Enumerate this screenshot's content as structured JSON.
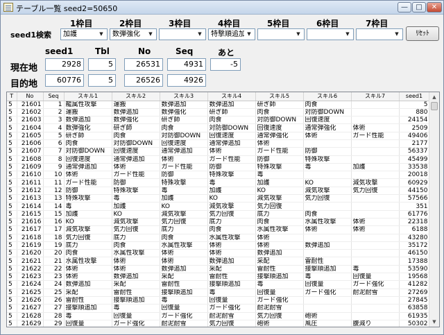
{
  "window": {
    "title": "テーブル一覧 seed2=50650",
    "min_glyph": "—",
    "max_glyph": "□",
    "close_glyph": "✕"
  },
  "search": {
    "label": "seed1検索",
    "frames": [
      {
        "label": "1枠目",
        "value": "加護"
      },
      {
        "label": "2枠目",
        "value": "数弾強化"
      },
      {
        "label": "3枠目",
        "value": ""
      },
      {
        "label": "4枠目",
        "value": "特撃順追加"
      },
      {
        "label": "5枠目",
        "value": ""
      },
      {
        "label": "6枠目",
        "value": ""
      },
      {
        "label": "7枠目",
        "value": ""
      }
    ],
    "reset_label": "ﾘｾｯﾄ",
    "arrow_glyph": "▼"
  },
  "status": {
    "headers": {
      "seed1": "seed1",
      "tbl": "Tbl",
      "no": "No",
      "seq": "Seq",
      "ato": "あと"
    },
    "current": {
      "label": "現在地",
      "seed1": "2928",
      "tbl": "5",
      "no": "26531",
      "seq": "4931",
      "ato": "-5"
    },
    "target": {
      "label": "目的地",
      "seed1": "60776",
      "tbl": "5",
      "no": "26526",
      "seq": "4926"
    }
  },
  "table": {
    "columns": [
      "T",
      "No",
      "Seq",
      "スキル1",
      "スキル2",
      "スキル3",
      "スキル4",
      "スキル5",
      "スキル6",
      "スキル7",
      "seed1"
    ],
    "rows": [
      [
        "5",
        "21601",
        "1",
        "龍属性攻撃",
        "運搬",
        "数弾追加",
        "数弾追加",
        "研ぎ師",
        "肉食",
        "",
        "5"
      ],
      [
        "5",
        "21602",
        "2",
        "運搬",
        "数弾追加",
        "数弾強化",
        "研ぎ師",
        "肉食",
        "対防御DOWN",
        "",
        "880"
      ],
      [
        "5",
        "21603",
        "3",
        "数弾追加",
        "数弾強化",
        "研ぎ師",
        "肉食",
        "対防御DOWN",
        "回復速度",
        "",
        "24154"
      ],
      [
        "5",
        "21604",
        "4",
        "数弾強化",
        "研ぎ師",
        "肉食",
        "対防御DOWN",
        "回復速度",
        "通常弾強化",
        "体術",
        "2509"
      ],
      [
        "5",
        "21605",
        "5",
        "研ぎ師",
        "肉食",
        "対防御DOWN",
        "回復速度",
        "通常弾強化",
        "体術",
        "ガード性能",
        "49406"
      ],
      [
        "5",
        "21606",
        "6",
        "肉食",
        "対防御DOWN",
        "回復速度",
        "通常弾追加",
        "体術",
        "",
        "",
        "2177"
      ],
      [
        "5",
        "21607",
        "7",
        "対防御DOWN",
        "回復速度",
        "通常弾追加",
        "体術",
        "ガード性能",
        "防御",
        "",
        "56337"
      ],
      [
        "5",
        "21608",
        "8",
        "回復速度",
        "通常弾追加",
        "体術",
        "ガード性能",
        "防御",
        "特殊攻撃",
        "",
        "45499"
      ],
      [
        "5",
        "21609",
        "9",
        "通常弾追加",
        "体術",
        "ガード性能",
        "防御",
        "特殊攻撃",
        "毒",
        "加護",
        "33538"
      ],
      [
        "5",
        "21610",
        "10",
        "体術",
        "ガード性能",
        "防御",
        "特殊攻撃",
        "毒",
        "",
        "",
        "20018"
      ],
      [
        "5",
        "21611",
        "11",
        "ガード性能",
        "防御",
        "特殊攻撃",
        "毒",
        "加護",
        "KO",
        "減気攻撃",
        "60929"
      ],
      [
        "5",
        "21612",
        "12",
        "防御",
        "特殊攻撃",
        "毒",
        "加護",
        "KO",
        "減気攻撃",
        "気力回復",
        "44150"
      ],
      [
        "5",
        "21613",
        "13",
        "特殊攻撃",
        "毒",
        "加護",
        "KO",
        "減気攻撃",
        "気力回復",
        "",
        "57566"
      ],
      [
        "5",
        "21614",
        "14",
        "毒",
        "加護",
        "KO",
        "減気攻撃",
        "気力回復",
        "",
        "",
        "351"
      ],
      [
        "5",
        "21615",
        "15",
        "加護",
        "KO",
        "減気攻撃",
        "気力回復",
        "底力",
        "肉食",
        "",
        "61776"
      ],
      [
        "5",
        "21616",
        "16",
        "KO",
        "減気攻撃",
        "気力回復",
        "底力",
        "肉食",
        "水属性攻撃",
        "体術",
        "22318"
      ],
      [
        "5",
        "21617",
        "17",
        "減気攻撃",
        "気力回復",
        "底力",
        "肉食",
        "水属性攻撃",
        "体術",
        "体術",
        "6188"
      ],
      [
        "5",
        "21618",
        "18",
        "気力回復",
        "底力",
        "肉食",
        "水属性攻撃",
        "体術",
        "",
        "",
        "43280"
      ],
      [
        "5",
        "21619",
        "19",
        "底力",
        "肉食",
        "水属性攻撃",
        "体術",
        "体術",
        "数弾追加",
        "",
        "35172"
      ],
      [
        "5",
        "21620",
        "20",
        "肉食",
        "水属性攻撃",
        "体術",
        "体術",
        "数弾追加",
        "",
        "",
        "46150"
      ],
      [
        "5",
        "21621",
        "21",
        "水属性攻撃",
        "体術",
        "体術",
        "数弾追加",
        "采配",
        "雷耐性",
        "",
        "17388"
      ],
      [
        "5",
        "21622",
        "22",
        "体術",
        "体術",
        "数弾追加",
        "采配",
        "雷耐性",
        "接撃順追加",
        "毒",
        "53590"
      ],
      [
        "5",
        "21623",
        "23",
        "体術",
        "数弾追加",
        "采配",
        "雷耐性",
        "接撃順追加",
        "毒",
        "回復量",
        "19568"
      ],
      [
        "5",
        "21624",
        "24",
        "数弾追加",
        "采配",
        "雷耐性",
        "接撃順追加",
        "毒",
        "回復量",
        "ガード強化",
        "41282"
      ],
      [
        "5",
        "21625",
        "25",
        "采配",
        "雷耐性",
        "接撃順追加",
        "毒",
        "回復量",
        "ガード強化",
        "耐泥耐雪",
        "27269"
      ],
      [
        "5",
        "21626",
        "26",
        "雷耐性",
        "接撃順追加",
        "毒",
        "回復量",
        "ガード強化",
        "",
        "",
        "27845"
      ],
      [
        "5",
        "21627",
        "27",
        "接撃順追加",
        "毒",
        "回復量",
        "ガード強化",
        "耐泥耐雪",
        "",
        "",
        "63858"
      ],
      [
        "5",
        "21628",
        "28",
        "毒",
        "回復量",
        "ガード強化",
        "耐泥耐雪",
        "気力回復",
        "砲術",
        "",
        "61935"
      ],
      [
        "5",
        "21629",
        "29",
        "回復量",
        "ガード強化",
        "耐泥耐雪",
        "気力回復",
        "砲術",
        "風圧",
        "腹減り",
        "50302"
      ],
      [
        "5",
        "21630",
        "30",
        "ガード強化",
        "耐泥耐雪",
        "気力回復",
        "砲術",
        "風圧",
        "腹減り",
        "",
        "29147"
      ]
    ]
  },
  "scroll": {
    "up_glyph": "▲",
    "down_glyph": "▼"
  }
}
